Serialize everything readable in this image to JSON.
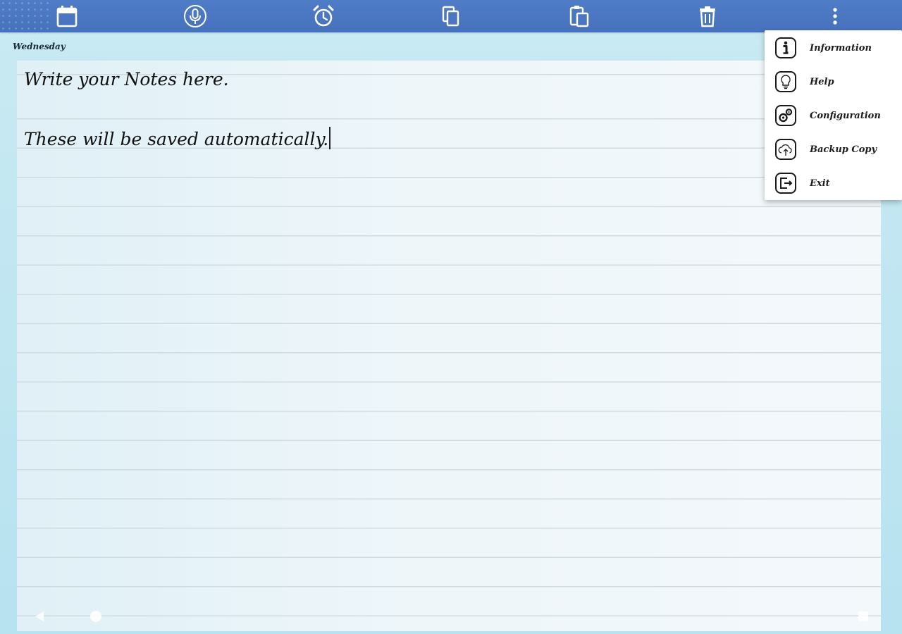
{
  "toolbar": {
    "buttons": [
      {
        "name": "calendar-button",
        "icon": "calendar-icon"
      },
      {
        "name": "microphone-button",
        "icon": "microphone-icon"
      },
      {
        "name": "alarm-button",
        "icon": "alarm-clock-icon"
      },
      {
        "name": "copy-button",
        "icon": "copy-icon"
      },
      {
        "name": "paste-button",
        "icon": "paste-icon"
      },
      {
        "name": "delete-button",
        "icon": "trash-icon"
      },
      {
        "name": "more-options-button",
        "icon": "more-vertical-icon"
      }
    ],
    "color": "#4a76c2"
  },
  "day_label": "Wednesday",
  "note": {
    "lines": [
      "Write your Notes here.",
      "These will be saved automatically."
    ]
  },
  "menu": {
    "items": [
      {
        "label": "Information",
        "icon": "info-icon"
      },
      {
        "label": "Help",
        "icon": "lightbulb-icon"
      },
      {
        "label": "Configuration",
        "icon": "gears-icon"
      },
      {
        "label": "Backup Copy",
        "icon": "cloud-backup-icon"
      },
      {
        "label": "Exit",
        "icon": "exit-icon"
      }
    ]
  }
}
